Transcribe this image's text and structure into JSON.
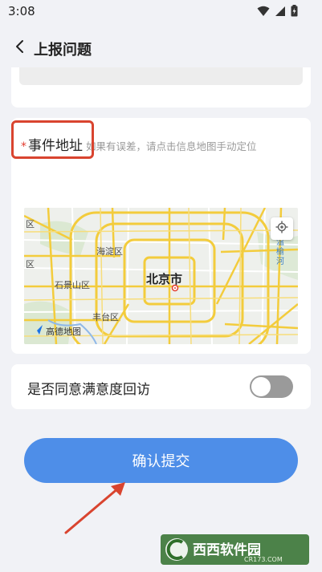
{
  "status_bar": {
    "time": "3:08",
    "icons": [
      "wifi-icon",
      "signal-icon",
      "battery-icon"
    ]
  },
  "header": {
    "back_icon": "chevron-left-icon",
    "title": "上报问题"
  },
  "address": {
    "required_mark": "*",
    "label": "事件地址",
    "hint": "如果有误差，请点击信息地图手动定位"
  },
  "map": {
    "city_label": "北京市",
    "district_labels": [
      "海淀区",
      "石景山区",
      "丰台区",
      "区",
      "区"
    ],
    "side_label": "温榆河",
    "provider_logo_text": "高德地图",
    "locate_icon": "locate-icon"
  },
  "satisfaction": {
    "label": "是否同意满意度回访",
    "enabled": false
  },
  "submit": {
    "label": "确认提交"
  },
  "watermark": {
    "text": "西西软件园",
    "sub_text": "CR173.COM"
  },
  "colors": {
    "accent": "#4e8ee8",
    "annotation": "#d9442f",
    "required": "#e23b2e",
    "background": "#f1f2f6"
  }
}
